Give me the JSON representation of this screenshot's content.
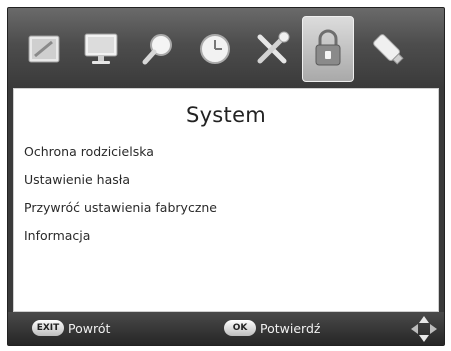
{
  "screen": {
    "title": "System"
  },
  "top_menu": [
    {
      "icon": "picture-icon",
      "active": false
    },
    {
      "icon": "monitor-icon",
      "active": false
    },
    {
      "icon": "search-icon",
      "active": false
    },
    {
      "icon": "clock-icon",
      "active": false
    },
    {
      "icon": "tools-icon",
      "active": false
    },
    {
      "icon": "lock-icon",
      "active": true
    },
    {
      "icon": "usb-icon",
      "active": false
    }
  ],
  "menu_items": [
    {
      "label": "Ochrona rodzicielska"
    },
    {
      "label": "Ustawienie hasła"
    },
    {
      "label": "Przywróć ustawienia fabryczne"
    },
    {
      "label": "Informacja"
    }
  ],
  "footer": {
    "exit_key": "EXIT",
    "exit_label": "Powrót",
    "ok_key": "OK",
    "ok_label": "Potwierdź",
    "nav_icon": "dpad-icon"
  },
  "colors": {
    "background": "#3a3a3a",
    "panel": "#ffffff",
    "text": "#2a2a2a"
  }
}
